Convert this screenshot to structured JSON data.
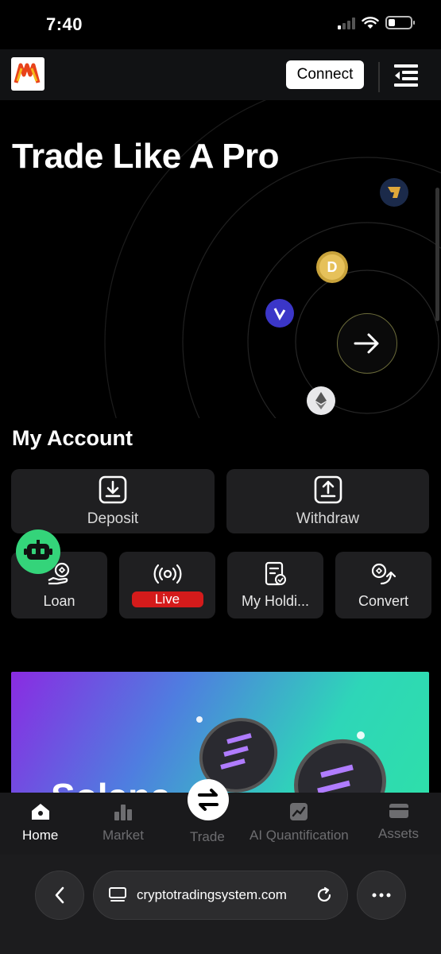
{
  "status_bar": {
    "time": "7:40"
  },
  "header": {
    "connect_label": "Connect"
  },
  "hero": {
    "title": "Trade Like A Pro"
  },
  "account": {
    "title": "My Account",
    "primary_actions": [
      {
        "label": "Deposit",
        "icon": "download-icon"
      },
      {
        "label": "Withdraw",
        "icon": "upload-icon"
      }
    ],
    "secondary_actions": [
      {
        "label": "Loan",
        "icon": "loan-icon"
      },
      {
        "label": "Live",
        "icon": "broadcast-icon"
      },
      {
        "label": "My Holdi...",
        "icon": "holdings-icon"
      },
      {
        "label": "Convert",
        "icon": "convert-icon"
      }
    ]
  },
  "banner": {
    "text": "Solana"
  },
  "bottom_nav": {
    "items": [
      {
        "label": "Home",
        "icon": "home-icon",
        "active": true
      },
      {
        "label": "Market",
        "icon": "bar-chart-icon",
        "active": false
      },
      {
        "label": "Trade",
        "icon": "swap-icon",
        "active": false
      },
      {
        "label": "AI Quantification",
        "icon": "chart-image-icon",
        "active": false
      },
      {
        "label": "Assets",
        "icon": "wallet-icon",
        "active": false
      }
    ]
  },
  "browser": {
    "url": "cryptotradingsystem.com"
  },
  "colors": {
    "live_red": "#d41b1b",
    "bot_green": "#34d47a",
    "background": "#000000"
  }
}
